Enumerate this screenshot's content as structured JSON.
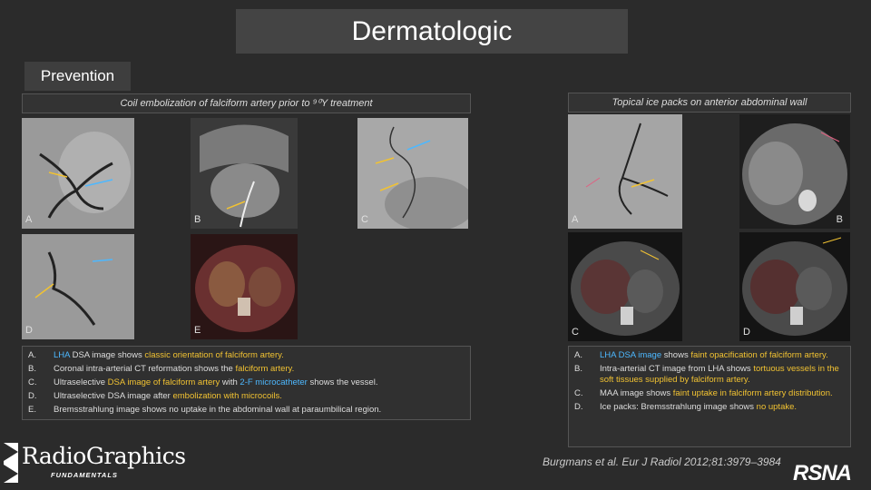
{
  "title": "Dermatologic",
  "section": "Prevention",
  "captions": {
    "left": "Coil embolization of falciform artery prior to ⁹⁰Y treatment",
    "right": "Topical ice packs on anterior abdominal wall"
  },
  "panels_left": [
    {
      "label": "A"
    },
    {
      "label": "B"
    },
    {
      "label": "C"
    },
    {
      "label": "D"
    },
    {
      "label": "E"
    }
  ],
  "panels_right": [
    {
      "label": "A"
    },
    {
      "label": "B"
    },
    {
      "label": "C"
    },
    {
      "label": "D"
    }
  ],
  "desc_left": [
    {
      "letter": "A.",
      "segments": [
        {
          "t": "LHA",
          "c": "blue"
        },
        {
          "t": " DSA image shows "
        },
        {
          "t": "classic orientation of falciform artery.",
          "c": "yellow"
        }
      ]
    },
    {
      "letter": "B.",
      "segments": [
        {
          "t": "Coronal intra-arterial CT reformation shows the "
        },
        {
          "t": "falciform artery.",
          "c": "yellow"
        }
      ]
    },
    {
      "letter": "C.",
      "segments": [
        {
          "t": "Ultraselective "
        },
        {
          "t": "DSA image of falciform artery",
          "c": "yellow"
        },
        {
          "t": " with "
        },
        {
          "t": "2-F microcatheter",
          "c": "blue"
        },
        {
          "t": " shows the vessel."
        }
      ]
    },
    {
      "letter": "D.",
      "segments": [
        {
          "t": "Ultraselective DSA image after "
        },
        {
          "t": "embolization with microcoils.",
          "c": "yellow"
        }
      ]
    },
    {
      "letter": "E.",
      "segments": [
        {
          "t": "Bremsstrahlung image shows no uptake in the abdominal wall at paraumbilical region."
        }
      ]
    }
  ],
  "desc_right": [
    {
      "letter": "A.",
      "segments": [
        {
          "t": "LHA DSA image",
          "c": "blue"
        },
        {
          "t": " shows "
        },
        {
          "t": "faint opacification of falciform artery.",
          "c": "yellow"
        }
      ]
    },
    {
      "letter": "B.",
      "segments": [
        {
          "t": "Intra-arterial CT image from LHA shows "
        },
        {
          "t": "tortuous vessels in the soft tissues supplied by falciform artery.",
          "c": "yellow"
        }
      ]
    },
    {
      "letter": "C.",
      "segments": [
        {
          "t": "MAA image shows "
        },
        {
          "t": "faint uptake in falciform artery distribution.",
          "c": "yellow"
        }
      ]
    },
    {
      "letter": "D.",
      "segments": [
        {
          "t": "Ice packs: Bremsstrahlung image shows "
        },
        {
          "t": "no uptake.",
          "c": "yellow"
        }
      ]
    }
  ],
  "logo": {
    "main": "RadioGraphics",
    "sub": "FUNDAMENTALS"
  },
  "citation": "Burgmans et al. Eur J Radiol 2012;81:3979–3984",
  "rsna": "RSNA",
  "colors": {
    "blue_highlight": "#4db8ff",
    "yellow_highlight": "#f1c232"
  }
}
